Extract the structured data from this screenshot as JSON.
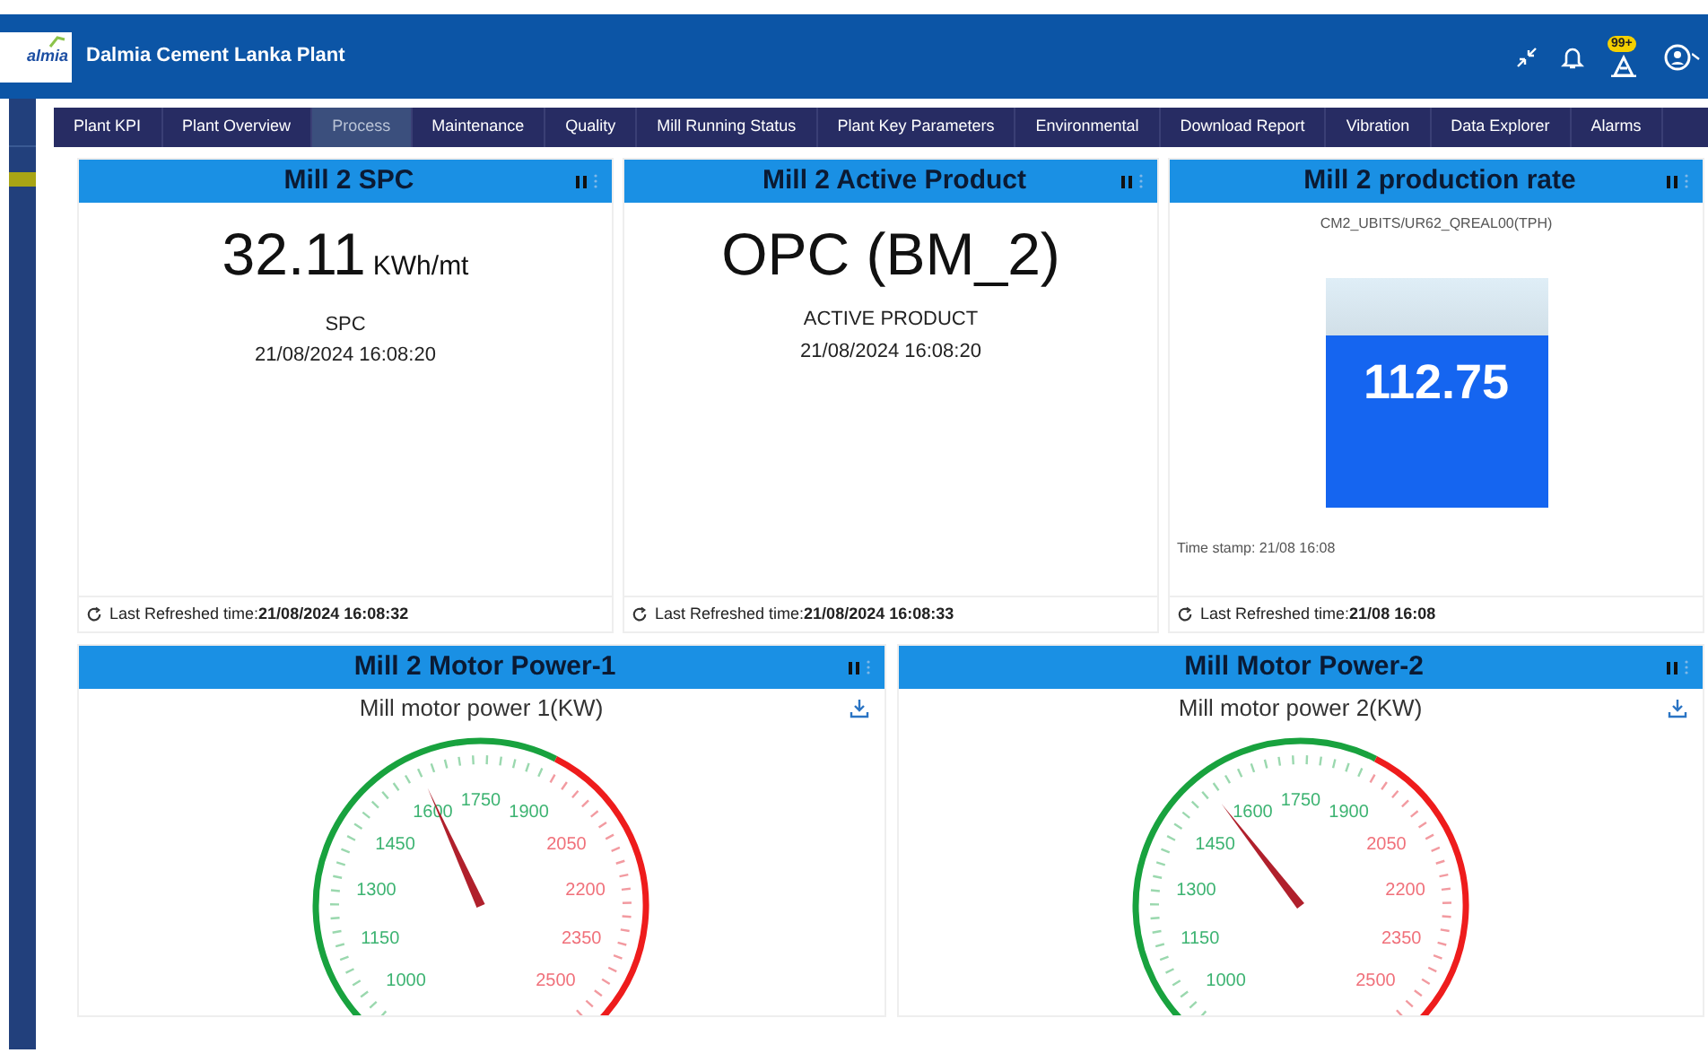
{
  "header": {
    "logo_text": "almia",
    "title": "Dalmia Cement Lanka Plant",
    "alarm_badge": "99+"
  },
  "nav": [
    {
      "label": "Plant KPI",
      "selected": false
    },
    {
      "label": "Plant Overview",
      "selected": false
    },
    {
      "label": "Process",
      "selected": true
    },
    {
      "label": "Maintenance",
      "selected": false
    },
    {
      "label": "Quality",
      "selected": false
    },
    {
      "label": "Mill Running Status",
      "selected": false
    },
    {
      "label": "Plant Key Parameters",
      "selected": false
    },
    {
      "label": "Environmental",
      "selected": false
    },
    {
      "label": "Download Report",
      "selected": false
    },
    {
      "label": "Vibration",
      "selected": false
    },
    {
      "label": "Data Explorer",
      "selected": false
    },
    {
      "label": "Alarms",
      "selected": false
    }
  ],
  "top_panels": [
    {
      "kind": "value",
      "title": "Mill 2 SPC",
      "value": "32.11",
      "unit": "KWh/mt",
      "caption": "SPC",
      "timestamp": "21/08/2024 16:08:20",
      "refreshed_label": "Last Refreshed time:",
      "refreshed_time": "21/08/2024 16:08:32"
    },
    {
      "kind": "value",
      "title": "Mill 2 Active Product",
      "value": "OPC (BM_2)",
      "caption": "ACTIVE PRODUCT",
      "timestamp": "21/08/2024 16:08:20",
      "refreshed_label": "Last Refreshed time:",
      "refreshed_time": "21/08/2024 16:08:33"
    },
    {
      "kind": "tank",
      "title": "Mill 2 production rate",
      "tag": "CM2_UBITS/UR62_QREAL00(TPH)",
      "value": "112.75",
      "level": 0.75,
      "timestamp": "Time stamp: 21/08 16:08",
      "refreshed_label": "Last Refreshed time:",
      "refreshed_time": "21/08 16:08"
    }
  ],
  "gauge_panels": [
    {
      "title": "Mill 2 Motor Power-1",
      "subtitle": "Mill motor power 1(KW)",
      "level": 0.41,
      "scale": [
        {
          "text": "1000",
          "color": "#3cb371"
        },
        {
          "text": "1150",
          "color": "#3cb371"
        },
        {
          "text": "1300",
          "color": "#3cb371"
        },
        {
          "text": "1450",
          "color": "#3cb371"
        },
        {
          "text": "1600",
          "color": "#3cb371"
        },
        {
          "text": "1750",
          "color": "#3cb371"
        },
        {
          "text": "1900",
          "color": "#3cb371"
        },
        {
          "text": "2050",
          "color": "#f0707a"
        },
        {
          "text": "2200",
          "color": "#f0707a"
        },
        {
          "text": "2350",
          "color": "#f0707a"
        },
        {
          "text": "2500",
          "color": "#f0707a"
        }
      ]
    },
    {
      "title": "Mill Motor Power-2",
      "subtitle": "Mill motor power 2(KW)",
      "level": 0.36,
      "scale": [
        {
          "text": "1000",
          "color": "#3cb371"
        },
        {
          "text": "1150",
          "color": "#3cb371"
        },
        {
          "text": "1300",
          "color": "#3cb371"
        },
        {
          "text": "1450",
          "color": "#3cb371"
        },
        {
          "text": "1600",
          "color": "#3cb371"
        },
        {
          "text": "1750",
          "color": "#3cb371"
        },
        {
          "text": "1900",
          "color": "#3cb371"
        },
        {
          "text": "2050",
          "color": "#f0707a"
        },
        {
          "text": "2200",
          "color": "#f0707a"
        },
        {
          "text": "2350",
          "color": "#f0707a"
        },
        {
          "text": "2500",
          "color": "#f0707a"
        }
      ]
    }
  ]
}
